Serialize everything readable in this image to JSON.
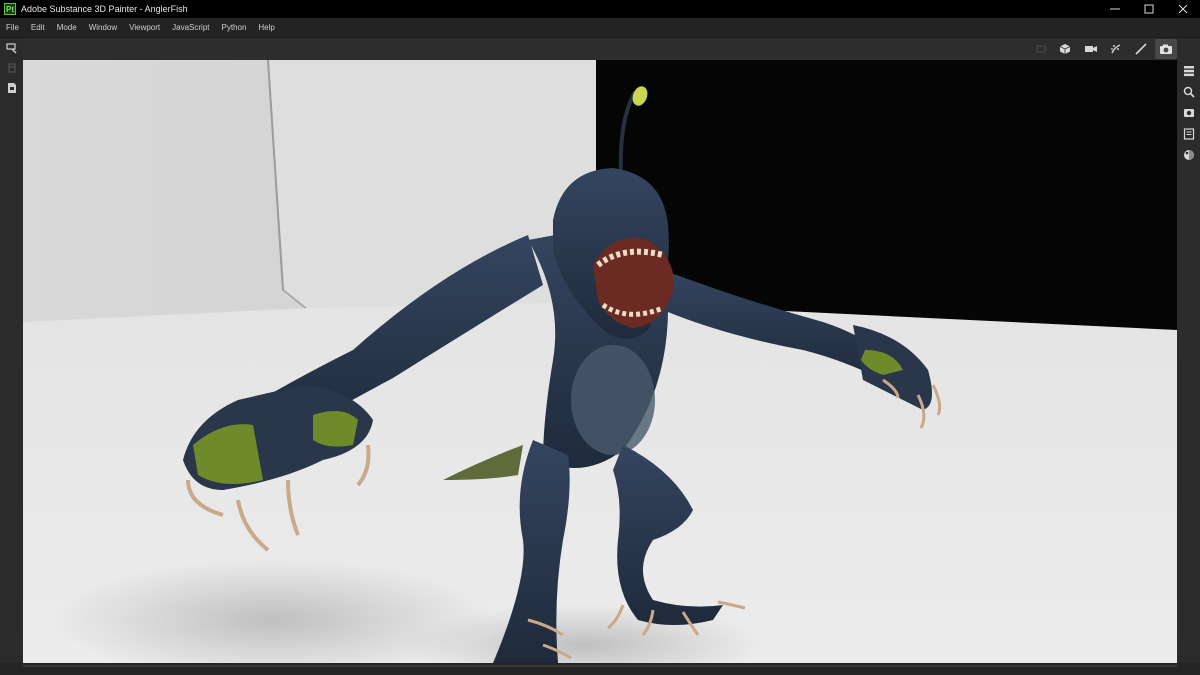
{
  "window": {
    "app_icon_text": "Pt",
    "title": "Adobe Substance 3D Painter - AnglerFish",
    "controls": [
      "minimize-icon",
      "maximize-icon",
      "close-icon"
    ]
  },
  "menu": {
    "items": [
      "File",
      "Edit",
      "Mode",
      "Window",
      "Viewport",
      "JavaScript",
      "Python",
      "Help"
    ]
  },
  "viewport_tools": {
    "items": [
      "frame-icon",
      "cube-view-icon",
      "camera-icon",
      "particles-icon",
      "brush-icon",
      "screenshot-icon"
    ],
    "active": "screenshot-icon"
  },
  "left_tools": [
    "paint-tool-icon",
    "layer-stack-icon",
    "document-icon"
  ],
  "right_panels": [
    "layers-panel-icon",
    "zoom-icon",
    "display-settings-icon",
    "properties-icon",
    "shader-icon"
  ],
  "scene": {
    "description_icon": "anglerfish-creature-model"
  },
  "colors": {
    "titlebar": "#000000",
    "menubar": "#232323",
    "panel": "#2b2b2b",
    "app_icon_green": "#7fdc4f",
    "creature_skin": "#2c3b52",
    "lure": "#c9d650"
  }
}
